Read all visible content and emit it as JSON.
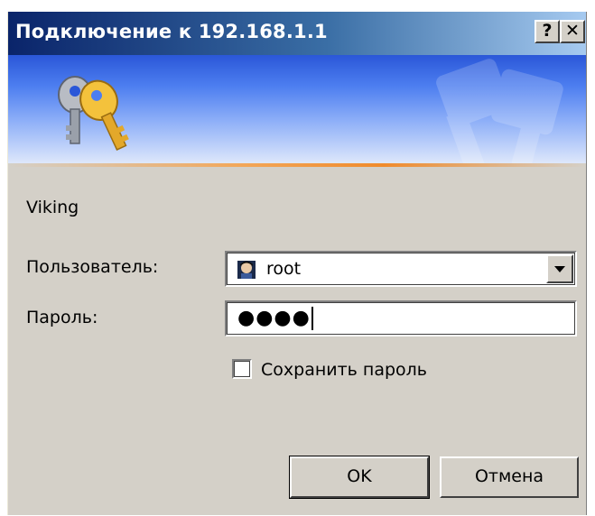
{
  "window": {
    "title": "Подключение к 192.168.1.1",
    "help_label": "?",
    "close_label": "✕"
  },
  "dialog": {
    "server_name": "Viking",
    "user_label": "Пользователь:",
    "user_value": "root",
    "password_label": "Пароль:",
    "password_masked": "●●●●",
    "remember_label": "Сохранить пароль",
    "remember_checked": false,
    "ok_label": "OK",
    "cancel_label": "Отмена"
  },
  "icons": {
    "banner": "keys-icon",
    "user": "user-avatar-icon",
    "dropdown": "chevron-down-icon"
  },
  "colors": {
    "titlebar_start": "#0a246a",
    "titlebar_end": "#a6caf0",
    "dialog_bg": "#d4d0c8",
    "banner_accent": "#f08b2c"
  }
}
